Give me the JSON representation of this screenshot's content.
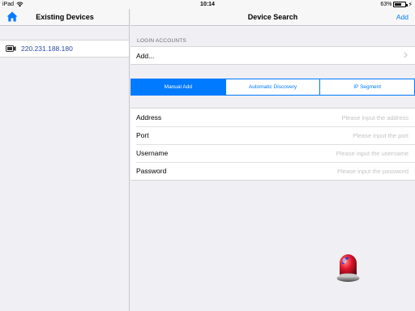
{
  "status_bar": {
    "device": "iPad",
    "time": "10:14",
    "battery": "63%",
    "battery_level": 0.63
  },
  "left_pane": {
    "title": "Existing Devices",
    "devices": [
      {
        "ip": "220.231.188.180"
      }
    ]
  },
  "right_pane": {
    "title": "Device Search",
    "add_label": "Add",
    "login_accounts": {
      "header": "LOGIN ACCOUNTS",
      "add_label": "Add..."
    },
    "segments": [
      {
        "label": "Manual Add",
        "active": true
      },
      {
        "label": "Automatic Discovery",
        "active": false
      },
      {
        "label": "IP Segment",
        "active": false
      }
    ],
    "form": {
      "address": {
        "label": "Address",
        "placeholder": "Please input the address",
        "value": ""
      },
      "port": {
        "label": "Port",
        "placeholder": "Please input the port",
        "value": ""
      },
      "username": {
        "label": "Username",
        "placeholder": "Please input the username",
        "value": ""
      },
      "password": {
        "label": "Password",
        "placeholder": "Please input the password",
        "value": ""
      }
    }
  },
  "colors": {
    "accent": "#007aff",
    "device_text": "#2c4aa5",
    "background": "#efeff4"
  },
  "icons": [
    "wifi-icon",
    "battery-icon",
    "charging-bolt-icon",
    "home-icon",
    "camera-icon",
    "chevron-right-icon",
    "alarm-siren-icon"
  ]
}
